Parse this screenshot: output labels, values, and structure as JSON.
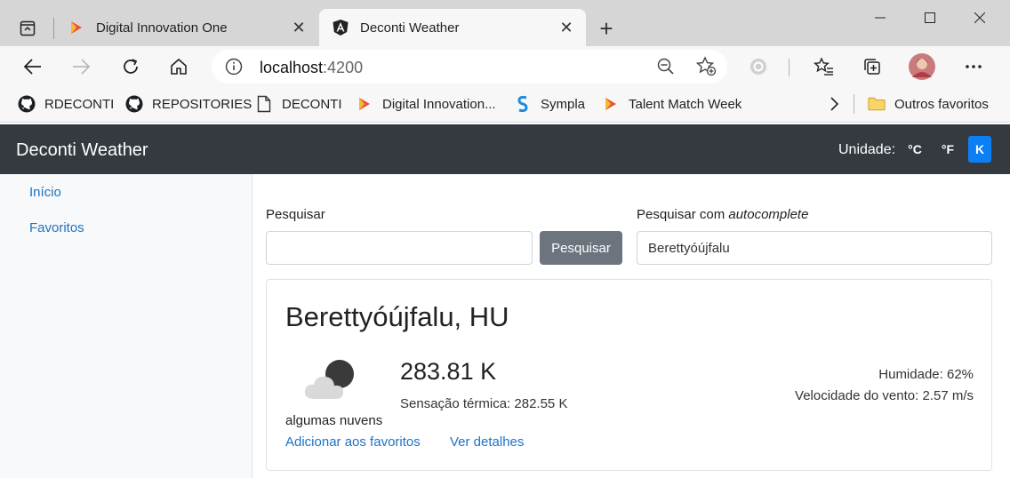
{
  "browser": {
    "tabs": [
      {
        "title": "Digital Innovation One",
        "active": false
      },
      {
        "title": "Deconti Weather",
        "active": true
      }
    ],
    "address": {
      "host": "localhost",
      "port": ":4200"
    },
    "bookmarks": [
      {
        "label": "RDECONTI",
        "icon": "github-icon"
      },
      {
        "label": "REPOSITORIES",
        "icon": "github-icon"
      },
      {
        "label": "DECONTI",
        "icon": "page-icon"
      },
      {
        "label": "Digital Innovation...",
        "icon": "dio-icon"
      },
      {
        "label": "Sympla",
        "icon": "sympla-icon"
      },
      {
        "label": "Talent Match Week",
        "icon": "dio-icon"
      }
    ],
    "other_favorites": "Outros favoritos"
  },
  "app": {
    "brand": "Deconti Weather",
    "unit_label": "Unidade:",
    "units": [
      "°C",
      "°F",
      "K"
    ],
    "selected_unit": "K",
    "sidebar": [
      {
        "label": "Início"
      },
      {
        "label": "Favoritos"
      }
    ],
    "search": {
      "label": "Pesquisar",
      "value": "",
      "button": "Pesquisar"
    },
    "autocomplete": {
      "label_prefix": "Pesquisar com ",
      "label_em": "autocomplete",
      "value": "Berettyóújfalu"
    },
    "weather": {
      "city": "Berettyóújfalu, HU",
      "condition": "algumas nuvens",
      "icon": "cloudy-night-icon",
      "temperature": "283.81 K",
      "feels_like": "Sensação térmica: 282.55 K",
      "humidity": "Humidade: 62%",
      "wind": "Velocidade do vento: 2.57 m/s",
      "add_favorite": "Adicionar aos favoritos",
      "details": "Ver detalhes"
    }
  },
  "colors": {
    "navbar": "#343a40",
    "accent": "#0d7ff5",
    "link": "#1a73c8",
    "button_secondary": "#6c757d"
  }
}
